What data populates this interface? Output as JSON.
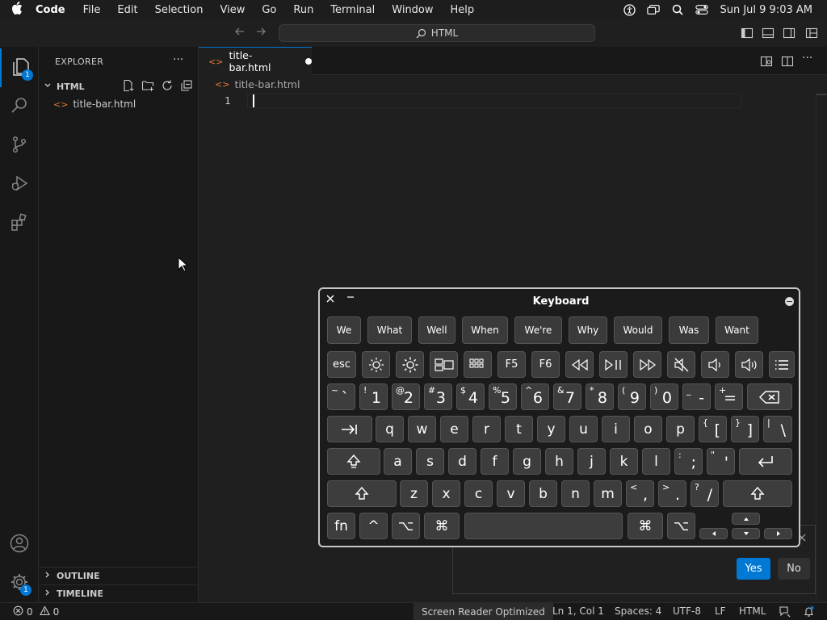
{
  "menubar": {
    "app": "Code",
    "items": [
      "File",
      "Edit",
      "Selection",
      "View",
      "Go",
      "Run",
      "Terminal",
      "Window",
      "Help"
    ],
    "clock": "Sun Jul 9  9:03 AM"
  },
  "title": {
    "command_center": "HTML"
  },
  "activity": {
    "explorer_badge": "1",
    "settings_badge": "1"
  },
  "sidebar": {
    "title": "EXPLORER",
    "more": "···",
    "folder": "HTML",
    "file": "title-bar.html",
    "outline": "OUTLINE",
    "timeline": "TIMELINE"
  },
  "editor": {
    "tab_label": "title-bar.html",
    "breadcrumb": "title-bar.html",
    "line_number": "1"
  },
  "dialog": {
    "yes": "Yes",
    "no": "No"
  },
  "statusbar": {
    "errors": "0",
    "warnings": "0",
    "screen_reader": "Screen Reader Optimized",
    "position": "Ln 1, Col 1",
    "spaces": "Spaces: 4",
    "encoding": "UTF-8",
    "eol": "LF",
    "language": "HTML"
  },
  "keyboard": {
    "title": "Keyboard",
    "suggestions": [
      "We",
      "What",
      "Well",
      "When",
      "We're",
      "Why",
      "Would",
      "Was",
      "Want"
    ],
    "esc": "esc",
    "f5": "F5",
    "f6": "F6",
    "row_numbers": [
      {
        "shift": "~",
        "main": "`"
      },
      {
        "shift": "!",
        "main": "1"
      },
      {
        "shift": "@",
        "main": "2"
      },
      {
        "shift": "#",
        "main": "3"
      },
      {
        "shift": "$",
        "main": "4"
      },
      {
        "shift": "%",
        "main": "5"
      },
      {
        "shift": "^",
        "main": "6"
      },
      {
        "shift": "&",
        "main": "7"
      },
      {
        "shift": "*",
        "main": "8"
      },
      {
        "shift": "(",
        "main": "9"
      },
      {
        "shift": ")",
        "main": "0"
      },
      {
        "shift": "_",
        "main": "-"
      },
      {
        "shift": "+",
        "main": "="
      }
    ],
    "row_q": [
      "q",
      "w",
      "e",
      "r",
      "t",
      "y",
      "u",
      "i",
      "o",
      "p"
    ],
    "row_q_symbols": [
      {
        "shift": "{",
        "main": "["
      },
      {
        "shift": "}",
        "main": "]"
      },
      {
        "shift": "|",
        "main": "\\"
      }
    ],
    "row_a": [
      "a",
      "s",
      "d",
      "f",
      "g",
      "h",
      "j",
      "k",
      "l"
    ],
    "row_a_symbols": [
      {
        "shift": ":",
        "main": ";"
      },
      {
        "shift": "\"",
        "main": "'"
      }
    ],
    "row_z": [
      "z",
      "x",
      "c",
      "v",
      "b",
      "n",
      "m"
    ],
    "row_z_symbols": [
      {
        "shift": "<",
        "main": ","
      },
      {
        "shift": ">",
        "main": "."
      },
      {
        "shift": "?",
        "main": "/"
      }
    ],
    "fn": "fn",
    "control": "^",
    "option": "⌥",
    "command": "⌘"
  },
  "colors": {
    "accent": "#0078d4",
    "html_icon": "#e37933",
    "background": "#1f1f1f",
    "sidebar": "#181818"
  }
}
